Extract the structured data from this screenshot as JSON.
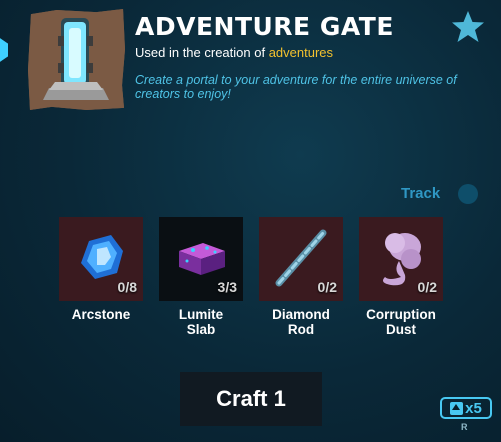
{
  "item": {
    "title": "ADVENTURE GATE",
    "subtitle_prefix": "Used in the creation of ",
    "subtitle_highlight": "adventures",
    "description": "Create a portal to your adventure for the entire universe of creators to enjoy!",
    "icon": "adventure-gate-portal"
  },
  "favorite": {
    "icon": "star-icon"
  },
  "track": {
    "label": "Track",
    "enabled": false
  },
  "ingredients": [
    {
      "name": "Arcstone",
      "count": "0/8",
      "icon": "arcstone-crystal"
    },
    {
      "name": "Lumite\nSlab",
      "count": "3/3",
      "icon": "lumite-slab"
    },
    {
      "name": "Diamond\nRod",
      "count": "0/2",
      "icon": "diamond-rod"
    },
    {
      "name": "Corruption\nDust",
      "count": "0/2",
      "icon": "corruption-dust"
    }
  ],
  "craft": {
    "label": "Craft 1"
  },
  "multiplier": {
    "label": "x5",
    "key": "R",
    "icon": "shift-arrow-icon"
  },
  "colors": {
    "highlight": "#f2c12e",
    "description": "#4fc3e6",
    "accent": "#48c8f2",
    "missing_bg": "#3a1a1f"
  }
}
